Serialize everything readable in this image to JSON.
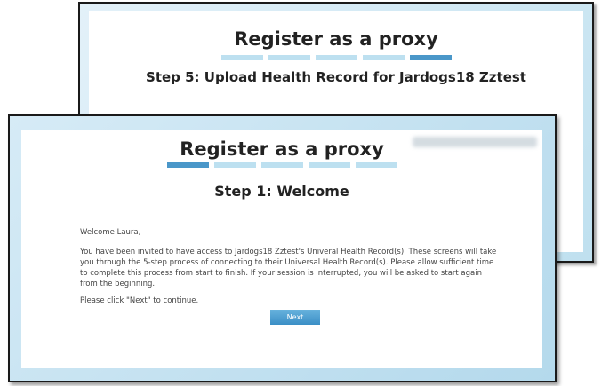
{
  "back_window": {
    "title": "Register as a proxy",
    "step_count": 5,
    "active_step": 5,
    "step_title": "Step 5: Upload Health Record for Jardogs18 Zztest"
  },
  "front_window": {
    "title": "Register as a proxy",
    "step_count": 5,
    "active_step": 1,
    "step_title": "Step 1: Welcome",
    "greeting": "Welcome Laura,",
    "message": "You have been invited to have access to Jardogs18 Zztest's Univeral Health Record(s). These screens will take you through the 5-step process of connecting to their Universal Health Record(s). Please allow sufficient time to complete this process from start to finish. If your session is interrupted, you will be asked to start again from the beginning.",
    "cta": "Please click \"Next\" to continue.",
    "next_label": "Next"
  },
  "colors": {
    "step_active": "#4a97c9",
    "step_inactive": "#bde0f0",
    "button": "#3b8fc6",
    "window_frame": "#bfe0ef"
  }
}
